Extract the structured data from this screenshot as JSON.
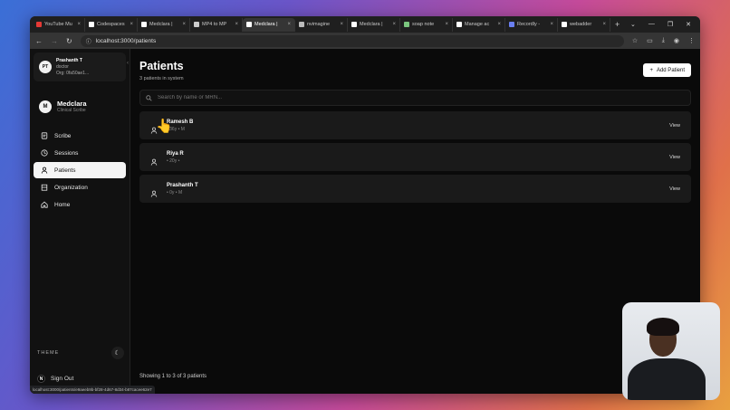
{
  "browser": {
    "tabs": [
      {
        "title": "YouTube Mu",
        "color": "#e53935"
      },
      {
        "title": "Codespaces",
        "color": "#ffffff"
      },
      {
        "title": "Medclara | ",
        "color": "#ffffff"
      },
      {
        "title": "MP4 to MP",
        "color": "#cccccc"
      },
      {
        "title": "Medclara | ",
        "color": "#ffffff"
      },
      {
        "title": "nvimagine",
        "color": "#bbbbbb"
      },
      {
        "title": "Medclara | ",
        "color": "#ffffff"
      },
      {
        "title": "soap note",
        "color": "#7bc67e"
      },
      {
        "title": "Manage ac",
        "color": "#ffffff"
      },
      {
        "title": "Recordly - ",
        "color": "#6a7ff0"
      },
      {
        "title": "webadder",
        "color": "#ffffff"
      }
    ],
    "active_tab_index": 4,
    "url": "localhost:3000/patients",
    "status_url": "localhost:3000/patients/e9aeeb9b-bf28-4d67-8d34-b87cacee62e7"
  },
  "sidebar": {
    "user": {
      "initials": "PT",
      "name": "Prashanth T",
      "role": "doctor",
      "org": "Org: 0fa50ae1..."
    },
    "brand": {
      "initial": "M",
      "name": "Medclara",
      "subtitle": "Clinical Scribe"
    },
    "nav_items": [
      {
        "label": "Scribe",
        "icon": "scribe-icon",
        "active": false
      },
      {
        "label": "Sessions",
        "icon": "clock-icon",
        "active": false
      },
      {
        "label": "Patients",
        "icon": "user-icon",
        "active": true
      },
      {
        "label": "Organization",
        "icon": "building-icon",
        "active": false
      },
      {
        "label": "Home",
        "icon": "home-icon",
        "active": false
      }
    ],
    "theme_label": "THEME",
    "sign_out_label": "Sign Out",
    "sign_out_initial": "N"
  },
  "main": {
    "title": "Patients",
    "subtitle": "3 patients in system",
    "add_button_label": "Add Patient",
    "search_placeholder": "Search by name or MRN...",
    "patients": [
      {
        "name": "Ramesh B",
        "meta": "• 36y • M",
        "action": "View"
      },
      {
        "name": "Riya R",
        "meta": "• 20y •",
        "action": "View"
      },
      {
        "name": "Prashanth T",
        "meta": "• 0y • M",
        "action": "View"
      }
    ],
    "footer": "Showing 1 to 3 of 3 patients"
  },
  "colors": {
    "accent": "#ffffff",
    "background": "#0a0a0a",
    "sidebar": "#111111",
    "row": "#1a1a1a"
  }
}
